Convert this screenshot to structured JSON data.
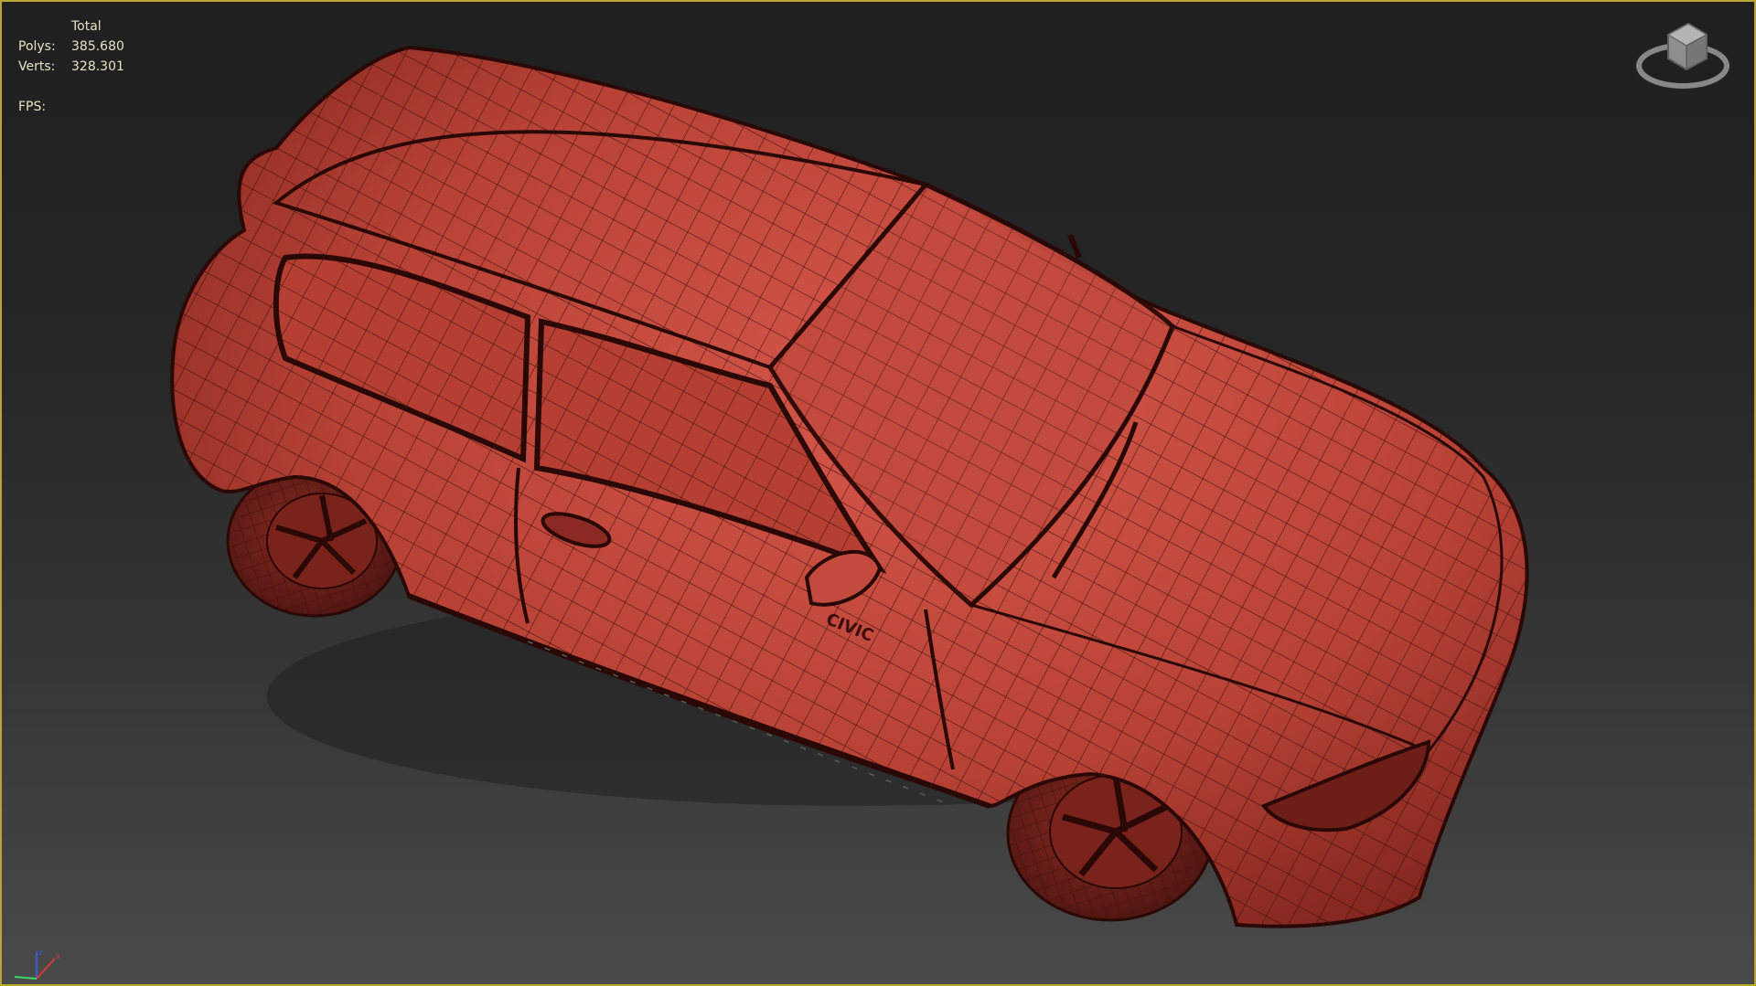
{
  "viewport": {
    "stats": {
      "total_label": "Total",
      "polys_label": "Polys:",
      "polys_value": "385.680",
      "verts_label": "Verts:",
      "verts_value": "328.301",
      "fps_label": "FPS:"
    },
    "model": {
      "decal_text": "CIVIC"
    },
    "colors": {
      "border": "#b8a532",
      "model_fill": "#c0463a",
      "wire": "#3c0e0c",
      "stats_text": "#e4e4c8"
    },
    "icons": [
      "viewcube-icon",
      "axis-tripod-icon"
    ]
  }
}
